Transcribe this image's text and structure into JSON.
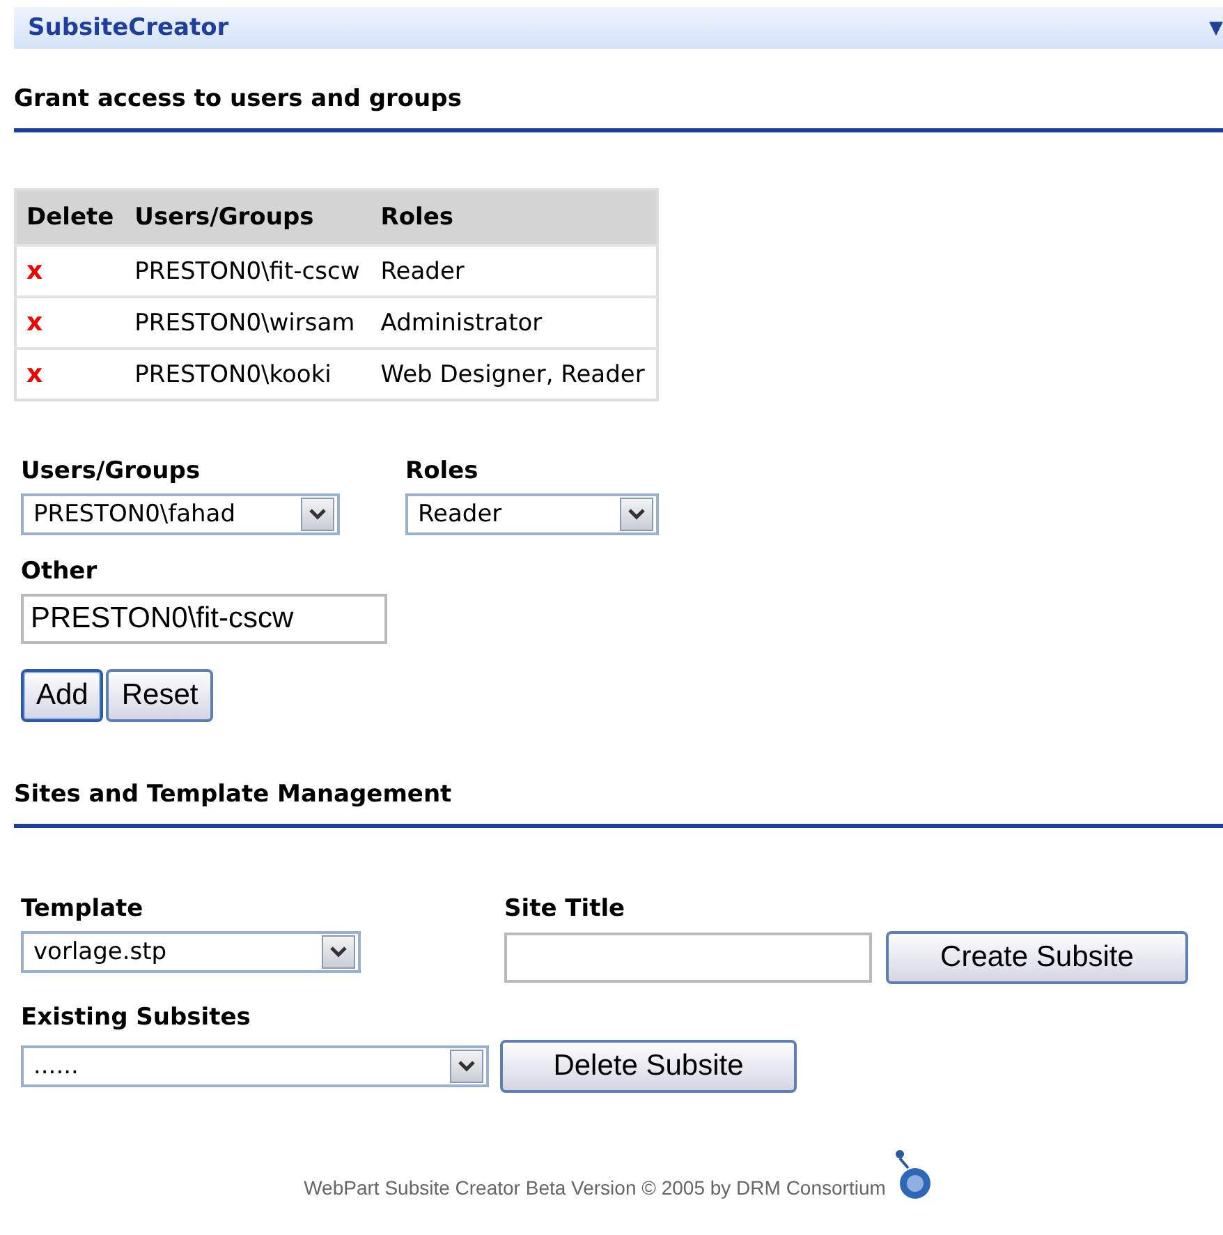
{
  "header": {
    "title": "SubsiteCreator",
    "menu_glyph": "▼"
  },
  "access_section": {
    "title": "Grant access to users and groups",
    "table": {
      "columns": [
        "Delete",
        "Users/Groups",
        "Roles"
      ],
      "rows": [
        {
          "delete": "x",
          "user": "PRESTON0\\fit-cscw",
          "roles": "Reader"
        },
        {
          "delete": "x",
          "user": "PRESTON0\\wirsam",
          "roles": "Administrator"
        },
        {
          "delete": "x",
          "user": "PRESTON0\\kooki",
          "roles": "Web Designer, Reader"
        }
      ]
    },
    "users_label": "Users/Groups",
    "users_value": "PRESTON0\\fahad",
    "roles_label": "Roles",
    "roles_value": "Reader",
    "other_label": "Other",
    "other_value": "PRESTON0\\fit-cscw",
    "buttons": [
      {
        "label": "Add",
        "focused": true
      },
      {
        "label": "Reset",
        "focused": false
      }
    ]
  },
  "sites_section": {
    "title": "Sites and Template Management",
    "template_label": "Template",
    "template_value": "vorlage.stp",
    "site_title_label": "Site Title",
    "create_button": "Create Subsite",
    "existing_label": "Existing Subsites",
    "existing_value": "......",
    "delete_button": "Delete Subsite"
  },
  "footer": "WebPart Subsite Creator Beta Version © 2005 by DRM Consortium"
}
